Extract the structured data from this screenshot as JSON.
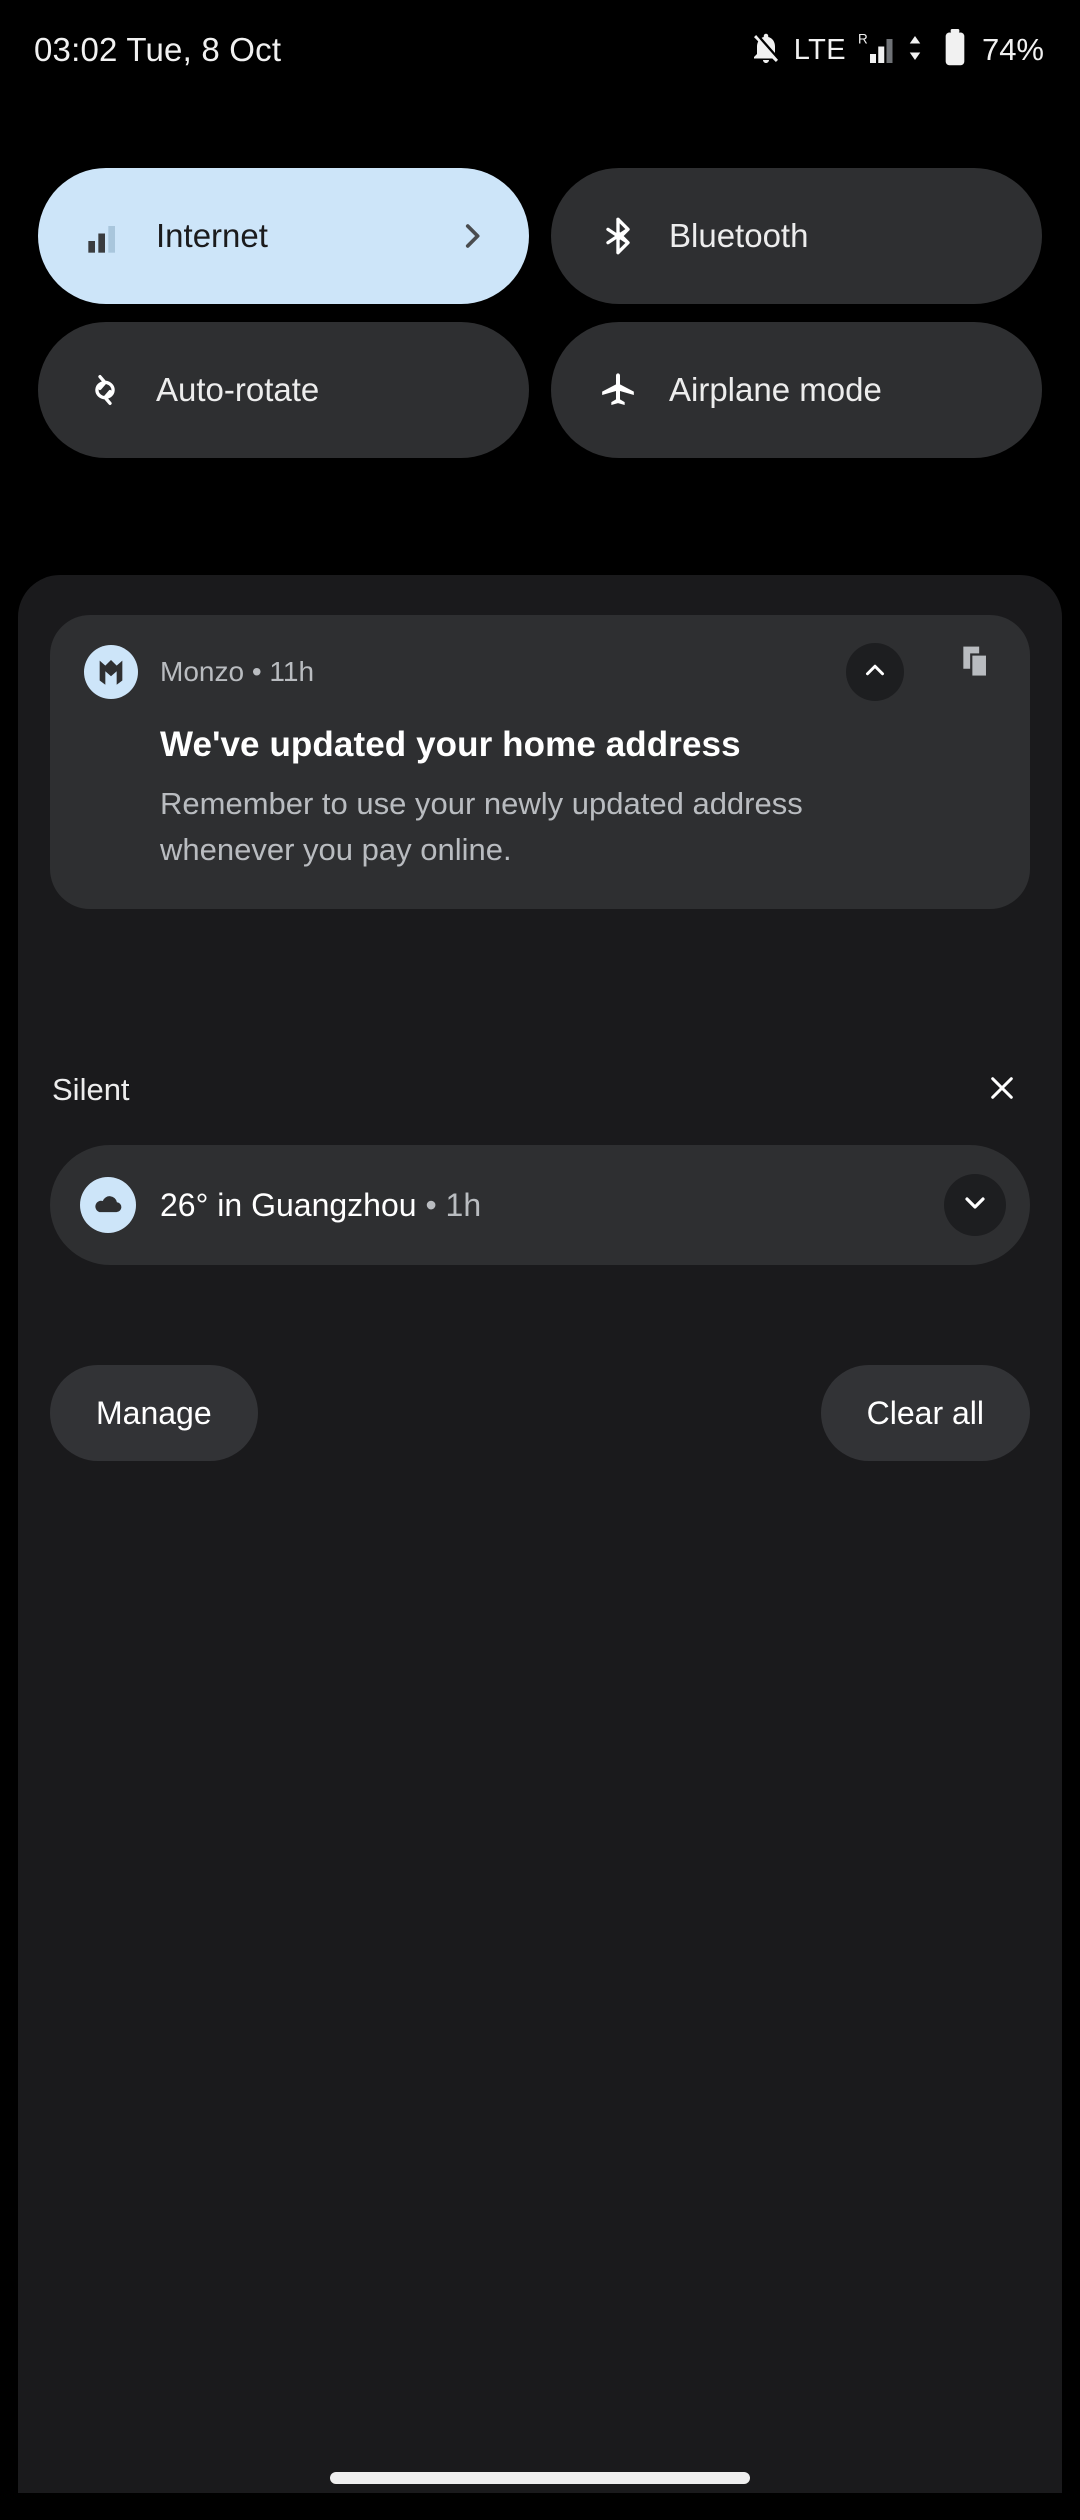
{
  "status_bar": {
    "clock": "03:02 Tue, 8 Oct",
    "network_type": "LTE",
    "roaming_indicator": "R",
    "battery_percent": "74%",
    "icons": [
      "notifications-off-icon",
      "signal-bars-icon",
      "data-transfer-icon",
      "battery-icon"
    ]
  },
  "quick_settings": {
    "tiles": [
      {
        "label": "Internet",
        "icon": "signal-bars-icon",
        "active": true,
        "has_chevron": true
      },
      {
        "label": "Bluetooth",
        "icon": "bluetooth-icon",
        "active": false,
        "has_chevron": false
      },
      {
        "label": "Auto-rotate",
        "icon": "auto-rotate-icon",
        "active": false,
        "has_chevron": false
      },
      {
        "label": "Airplane mode",
        "icon": "airplane-icon",
        "active": false,
        "has_chevron": false
      }
    ]
  },
  "notifications": {
    "alerting": {
      "app_name": "Monzo",
      "separator": "•",
      "time": "11h",
      "header_line": "Monzo • 11h",
      "title": "We've updated your home address",
      "body": "Remember to use your newly updated address whenever you pay online.",
      "avatar_letter": "M",
      "collapse_icon": "chevron-up-icon",
      "corner_icon": "copy-icon"
    },
    "silent_section": {
      "label": "Silent",
      "close_icon": "close-icon"
    },
    "silent": {
      "title": "26° in Guangzhou",
      "separator": "•",
      "time": "1h",
      "icon": "cloud-icon",
      "expand_icon": "chevron-down-icon"
    },
    "actions": {
      "manage_label": "Manage",
      "clear_all_label": "Clear all"
    }
  },
  "colors": {
    "screen_background": "#000000",
    "shade_background": "#1A1A1C",
    "tile_inactive": "#2E2F31",
    "tile_active": "#CDE5F9",
    "accent_light_blue": "#CDE5F9",
    "text_primary": "#FFFFFF",
    "text_secondary": "#B9BCC0",
    "nav_pill": "#EFEFEF"
  },
  "navigation": {
    "gesture_pill": "home-gesture-pill"
  }
}
